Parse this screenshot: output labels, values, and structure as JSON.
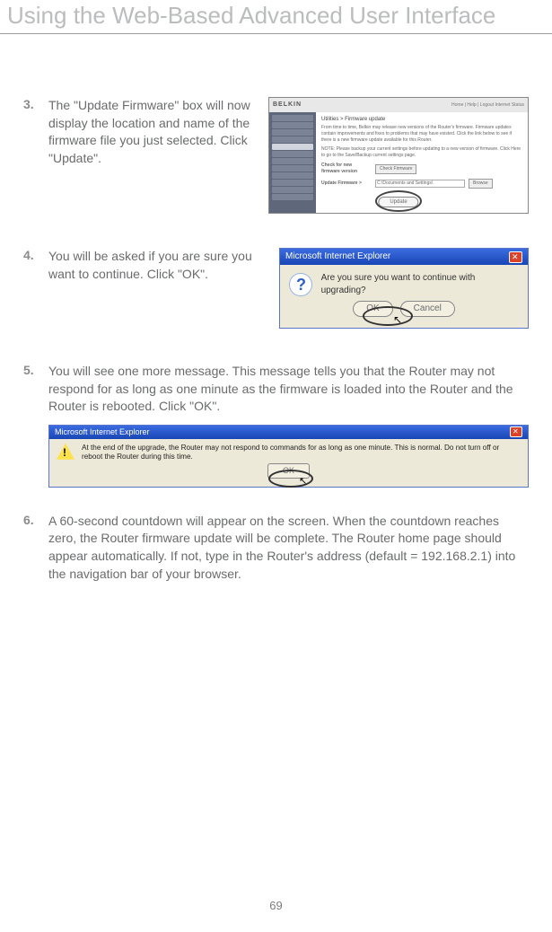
{
  "title": "Using the Web-Based Advanced User Interface",
  "page_number": "69",
  "steps": [
    {
      "num": "3.",
      "text": "The \"Update Firmware\" box will now display the location and name of the firmware file you just selected. Click \"Update\"."
    },
    {
      "num": "4.",
      "text": "You will be asked if you are sure you want to continue. Click \"OK\"."
    },
    {
      "num": "5.",
      "text": "You will see one more message. This message tells you that the Router may not respond for as long as one minute as the firmware is loaded into the Router and the Router is rebooted. Click \"OK\"."
    },
    {
      "num": "6.",
      "text": "A 60-second countdown will appear on the screen. When the countdown reaches zero, the Router firmware update will be complete. The Router home page should appear automatically. If not, type in the Router's address (default = 192.168.2.1) into the navigation bar of your browser."
    }
  ],
  "shot1": {
    "logo": "BELKIN",
    "top_right": "Home | Help | Logout   Internet Status",
    "heading": "Utilities > Firmware update",
    "desc1": "From time to time, Belkin may release new versions of the Router's firmware. Firmware updates contain improvements and fixes to problems that may have existed. Click the link below to see if there is a new firmware update available for this Router.",
    "desc2": "NOTE: Please backup your current settings before updating to a new version of firmware. Click Here to go to the Save/Backup current settings page.",
    "row1_label": "Check for new firmware version",
    "row1_btn": "Check Firmware",
    "row2_label": "Update Firmware >",
    "row2_field": "C:\\Documents and Settings\\",
    "row2_btn": "Browse",
    "update_btn": "Update"
  },
  "shot2": {
    "title": "Microsoft Internet Explorer",
    "message": "Are you sure you want to continue with upgrading?",
    "ok": "OK",
    "cancel": "Cancel"
  },
  "shot3": {
    "title": "Microsoft Internet Explorer",
    "message": "At the end of the upgrade, the Router may not respond to commands for as long as one minute. This is normal. Do not turn off or reboot the Router during this time.",
    "ok": "OK"
  }
}
